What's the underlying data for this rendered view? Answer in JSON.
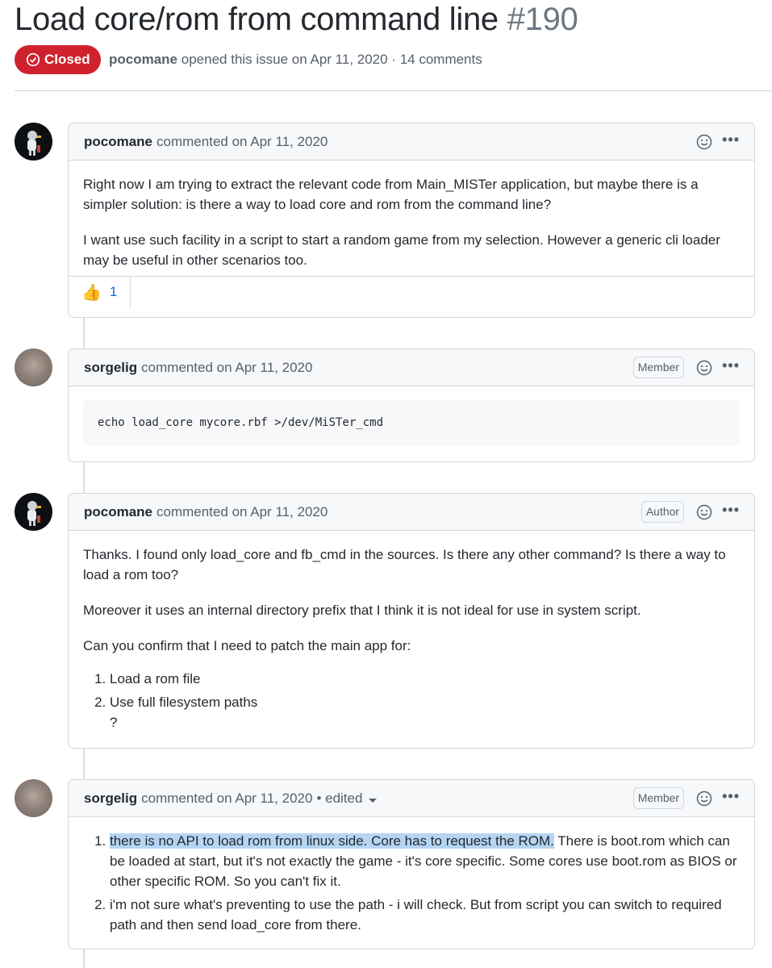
{
  "issue": {
    "title": "Load core/rom from command line",
    "number": "#190",
    "state": "Closed",
    "opened_by": "pocomane",
    "opened_text": "opened this issue on Apr 11, 2020 · 14 comments"
  },
  "comments": [
    {
      "author": "pocomane",
      "date_text": "commented on Apr 11, 2020",
      "paragraphs": [
        "Right now I am trying to extract the relevant code from Main_MISTer application, but maybe there is a simpler solution: is there a way to load core and rom from the command line?",
        "I want use such facility in a script to start a random game from my selection. However a generic cli loader may be useful in other scenarios too."
      ],
      "reaction_emoji": "👍",
      "reaction_count": "1"
    },
    {
      "author": "sorgelig",
      "date_text": "commented on Apr 11, 2020",
      "badge": "Member",
      "code": "echo load_core mycore.rbf >/dev/MiSTer_cmd"
    },
    {
      "author": "pocomane",
      "date_text": "commented on Apr 11, 2020",
      "badge": "Author",
      "paragraphs": [
        "Thanks. I found only load_core and fb_cmd in the sources. Is there any other command? Is there a way to load a rom too?",
        "Moreover it uses an internal directory prefix that I think it is not ideal for use in system script.",
        "Can you confirm that I need to patch the main app for:"
      ],
      "list": [
        "Load a rom file",
        "Use full filesystem paths"
      ],
      "trailing": "?"
    },
    {
      "author": "sorgelig",
      "date_text": "commented on Apr 11, 2020",
      "edited": "• edited",
      "badge": "Member",
      "list_highlight": "there is no API to load rom from linux side. Core has to request the ROM.",
      "list_first_rest": " There is boot.rom which can be loaded at start, but it's not exactly the game - it's core specific. Some cores use boot.rom as BIOS or other specific ROM. So you can't fix it.",
      "list_second": "i'm not sure what's preventing to use the path - i will check. But from script you can switch to required path and then send load_core from there."
    }
  ],
  "icons": [
    "closed-issue-icon",
    "smiley-icon",
    "more-options-icon",
    "thumbs-up-icon",
    "caret-down-icon"
  ],
  "colors": {
    "closed": "#cf222e",
    "link": "#0969da",
    "highlight": "#b6d5f2"
  }
}
